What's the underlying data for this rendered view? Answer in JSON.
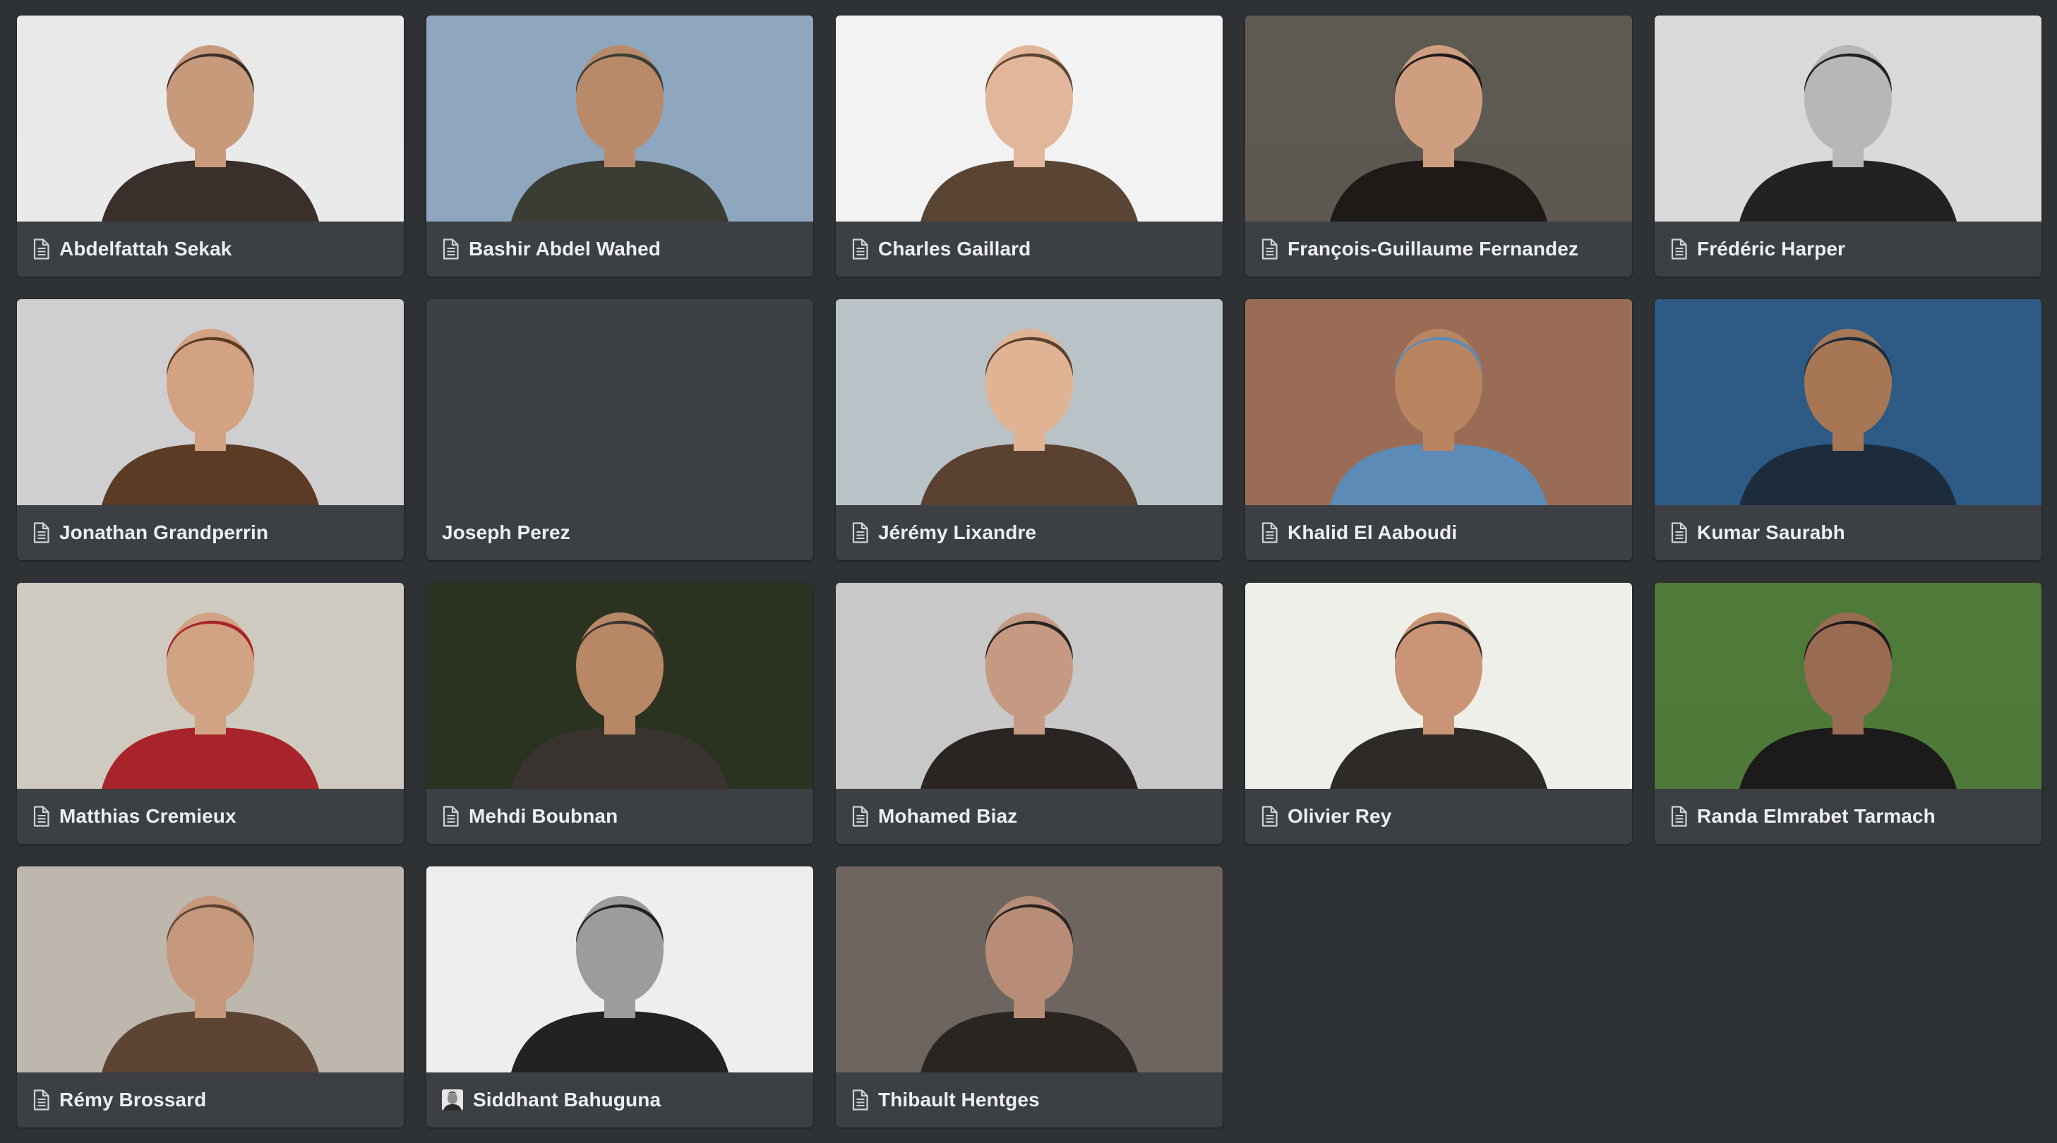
{
  "gallery": {
    "cards": [
      {
        "name": "Abdelfattah Sekak",
        "icon": "document-icon",
        "bg": "#e9e9ea",
        "fg": "#3a2f2a",
        "skin": "#c89a7c"
      },
      {
        "name": "Bashir Abdel Wahed",
        "icon": "document-icon",
        "bg": "#8fa6bf",
        "fg": "#3b3d35",
        "skin": "#b98a6a"
      },
      {
        "name": "Charles Gaillard",
        "icon": "document-icon",
        "bg": "#f2f2f2",
        "fg": "#5a4535",
        "skin": "#e2b69a"
      },
      {
        "name": "François-Guillaume Fernandez",
        "icon": "document-icon",
        "bg": "#5d5a52",
        "fg": "#1e1a17",
        "skin": "#cf9e80"
      },
      {
        "name": "Frédéric Harper",
        "icon": "document-icon",
        "bg": "#d9d9d9",
        "fg": "#222222",
        "skin": "#b7b7b7"
      },
      {
        "name": "Jonathan Grandperrin",
        "icon": "document-icon",
        "bg": "#cfcfd1",
        "fg": "#5b3b24",
        "skin": "#d3a283"
      },
      {
        "name": "Joseph Perez",
        "icon": "none",
        "bg": "",
        "fg": "",
        "skin": ""
      },
      {
        "name": "Jérémy Lixandre",
        "icon": "document-icon",
        "bg": "#b9c3c7",
        "fg": "#5a4130",
        "skin": "#e0b394"
      },
      {
        "name": "Khalid El Aaboudi",
        "icon": "document-icon",
        "bg": "#9a6c55",
        "fg": "#5d8bb8",
        "skin": "#b98560"
      },
      {
        "name": "Kumar Saurabh",
        "icon": "document-icon",
        "bg": "#2d5b86",
        "fg": "#1d2c3d",
        "skin": "#a77755"
      },
      {
        "name": "Matthias Cremieux",
        "icon": "document-icon",
        "bg": "#cfcac0",
        "fg": "#a8242a",
        "skin": "#d1a284"
      },
      {
        "name": "Mehdi Boubnan",
        "icon": "document-icon",
        "bg": "#2b3320",
        "fg": "#3a3430",
        "skin": "#b88866"
      },
      {
        "name": "Mohamed Biaz",
        "icon": "document-icon",
        "bg": "#c8c8c8",
        "fg": "#2a2522",
        "skin": "#c69a82"
      },
      {
        "name": "Olivier Rey",
        "icon": "document-icon",
        "bg": "#efefe9",
        "fg": "#2e2a27",
        "skin": "#c99576"
      },
      {
        "name": "Randa Elmrabet Tarmach",
        "icon": "document-icon",
        "bg": "#4f7a3a",
        "fg": "#1c1a1a",
        "skin": "#9a6b53"
      },
      {
        "name": "Rémy Brossard",
        "icon": "document-icon",
        "bg": "#bdb7ae",
        "fg": "#5e4433",
        "skin": "#c6987c"
      },
      {
        "name": "Siddhant Bahuguna",
        "icon": "avatar-icon",
        "bg": "#eeeeee",
        "fg": "#222222",
        "skin": "#9c9c9c"
      },
      {
        "name": "Thibault Hentges",
        "icon": "document-icon",
        "bg": "#6e6560",
        "fg": "#2b2522",
        "skin": "#b88d77"
      }
    ]
  }
}
